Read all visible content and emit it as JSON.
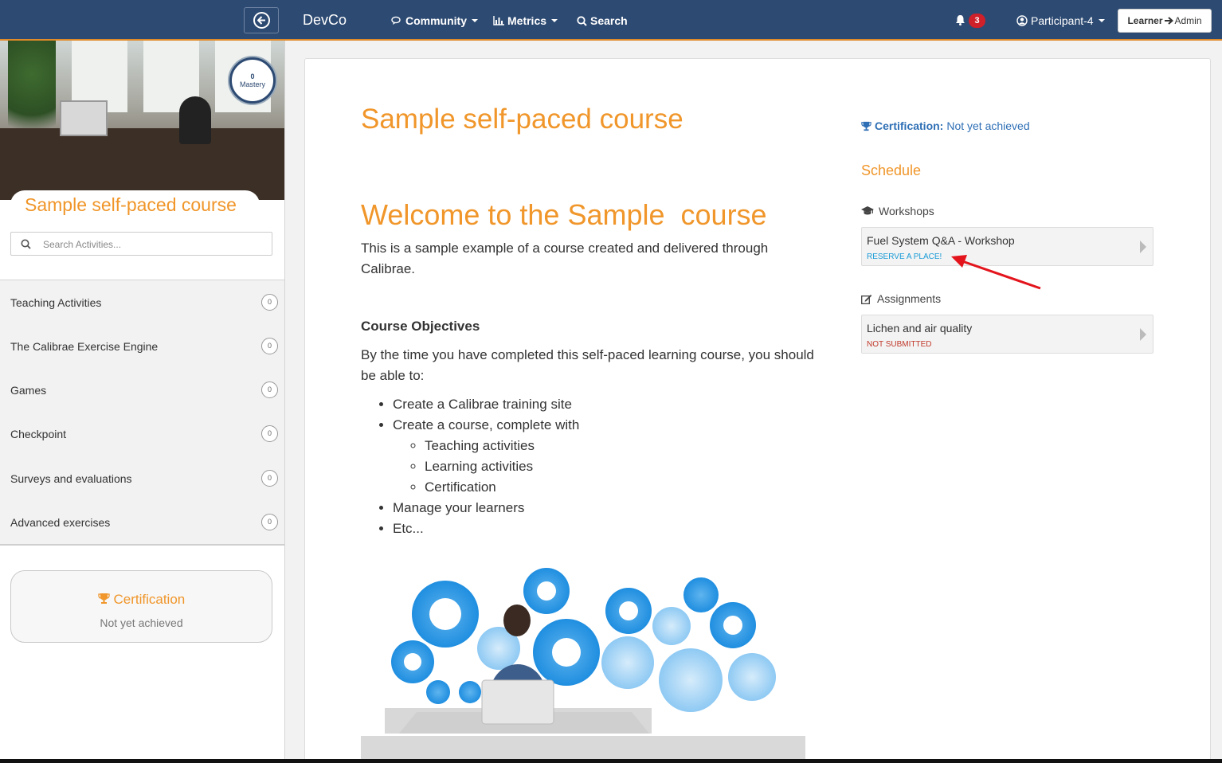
{
  "navbar": {
    "brand": "DevCo",
    "community": "Community",
    "metrics": "Metrics",
    "search": "Search",
    "notif_count": "3",
    "user": "Participant-4",
    "switch_from": "Learner",
    "switch_to": "Admin",
    "icons": [
      "back-circle-icon",
      "chat-icon",
      "bar-chart-icon",
      "search-icon",
      "bell-icon",
      "user-circle-icon",
      "arrow-right-icon"
    ]
  },
  "sidebar": {
    "mastery_value": "0",
    "mastery_label": "Mastery",
    "course_title": "Sample self-paced course",
    "search_placeholder": "Search Activities...",
    "activities": [
      {
        "label": "Teaching Activities",
        "count": "0"
      },
      {
        "label": "The Calibrae Exercise Engine",
        "count": "0"
      },
      {
        "label": "Games",
        "count": "0"
      },
      {
        "label": "Checkpoint",
        "count": "0"
      },
      {
        "label": "Surveys and evaluations",
        "count": "0"
      },
      {
        "label": "Advanced exercises",
        "count": "0"
      }
    ],
    "certification_title": "Certification",
    "certification_status": "Not yet achieved"
  },
  "main": {
    "course_title": "Sample self-paced course",
    "welcome": "Welcome to the Sample  course",
    "intro": "This is a sample example of a course created and delivered through Calibrae.",
    "objectives_heading": "Course Objectives",
    "objectives_text": "By the time you have completed this self-paced learning course, you should be able to:",
    "objectives": {
      "item1": "Create a Calibrae training site",
      "item2": "Create a course, complete with",
      "sub1": "Teaching activities",
      "sub2": "Learning activities",
      "sub3": "Certification",
      "item3": "Manage your learners",
      "item4": "Etc..."
    }
  },
  "right": {
    "cert_label": "Certification:",
    "cert_value": "Not yet achieved",
    "schedule": "Schedule",
    "workshops_heading": "Workshops",
    "workshop": {
      "name": "Fuel System Q&A - Workshop",
      "status": "RESERVE A PLACE!"
    },
    "assignments_heading": "Assignments",
    "assignment": {
      "name": "Lichen and air quality",
      "status": "NOT SUBMITTED"
    }
  },
  "colors": {
    "navbar": "#2d4a72",
    "accent_orange": "#f0962a",
    "link_blue": "#2e6fb5",
    "reserve_blue": "#1a9bd7",
    "not_submitted_red": "#c0392b",
    "annotation_arrow": "#e3141c"
  }
}
